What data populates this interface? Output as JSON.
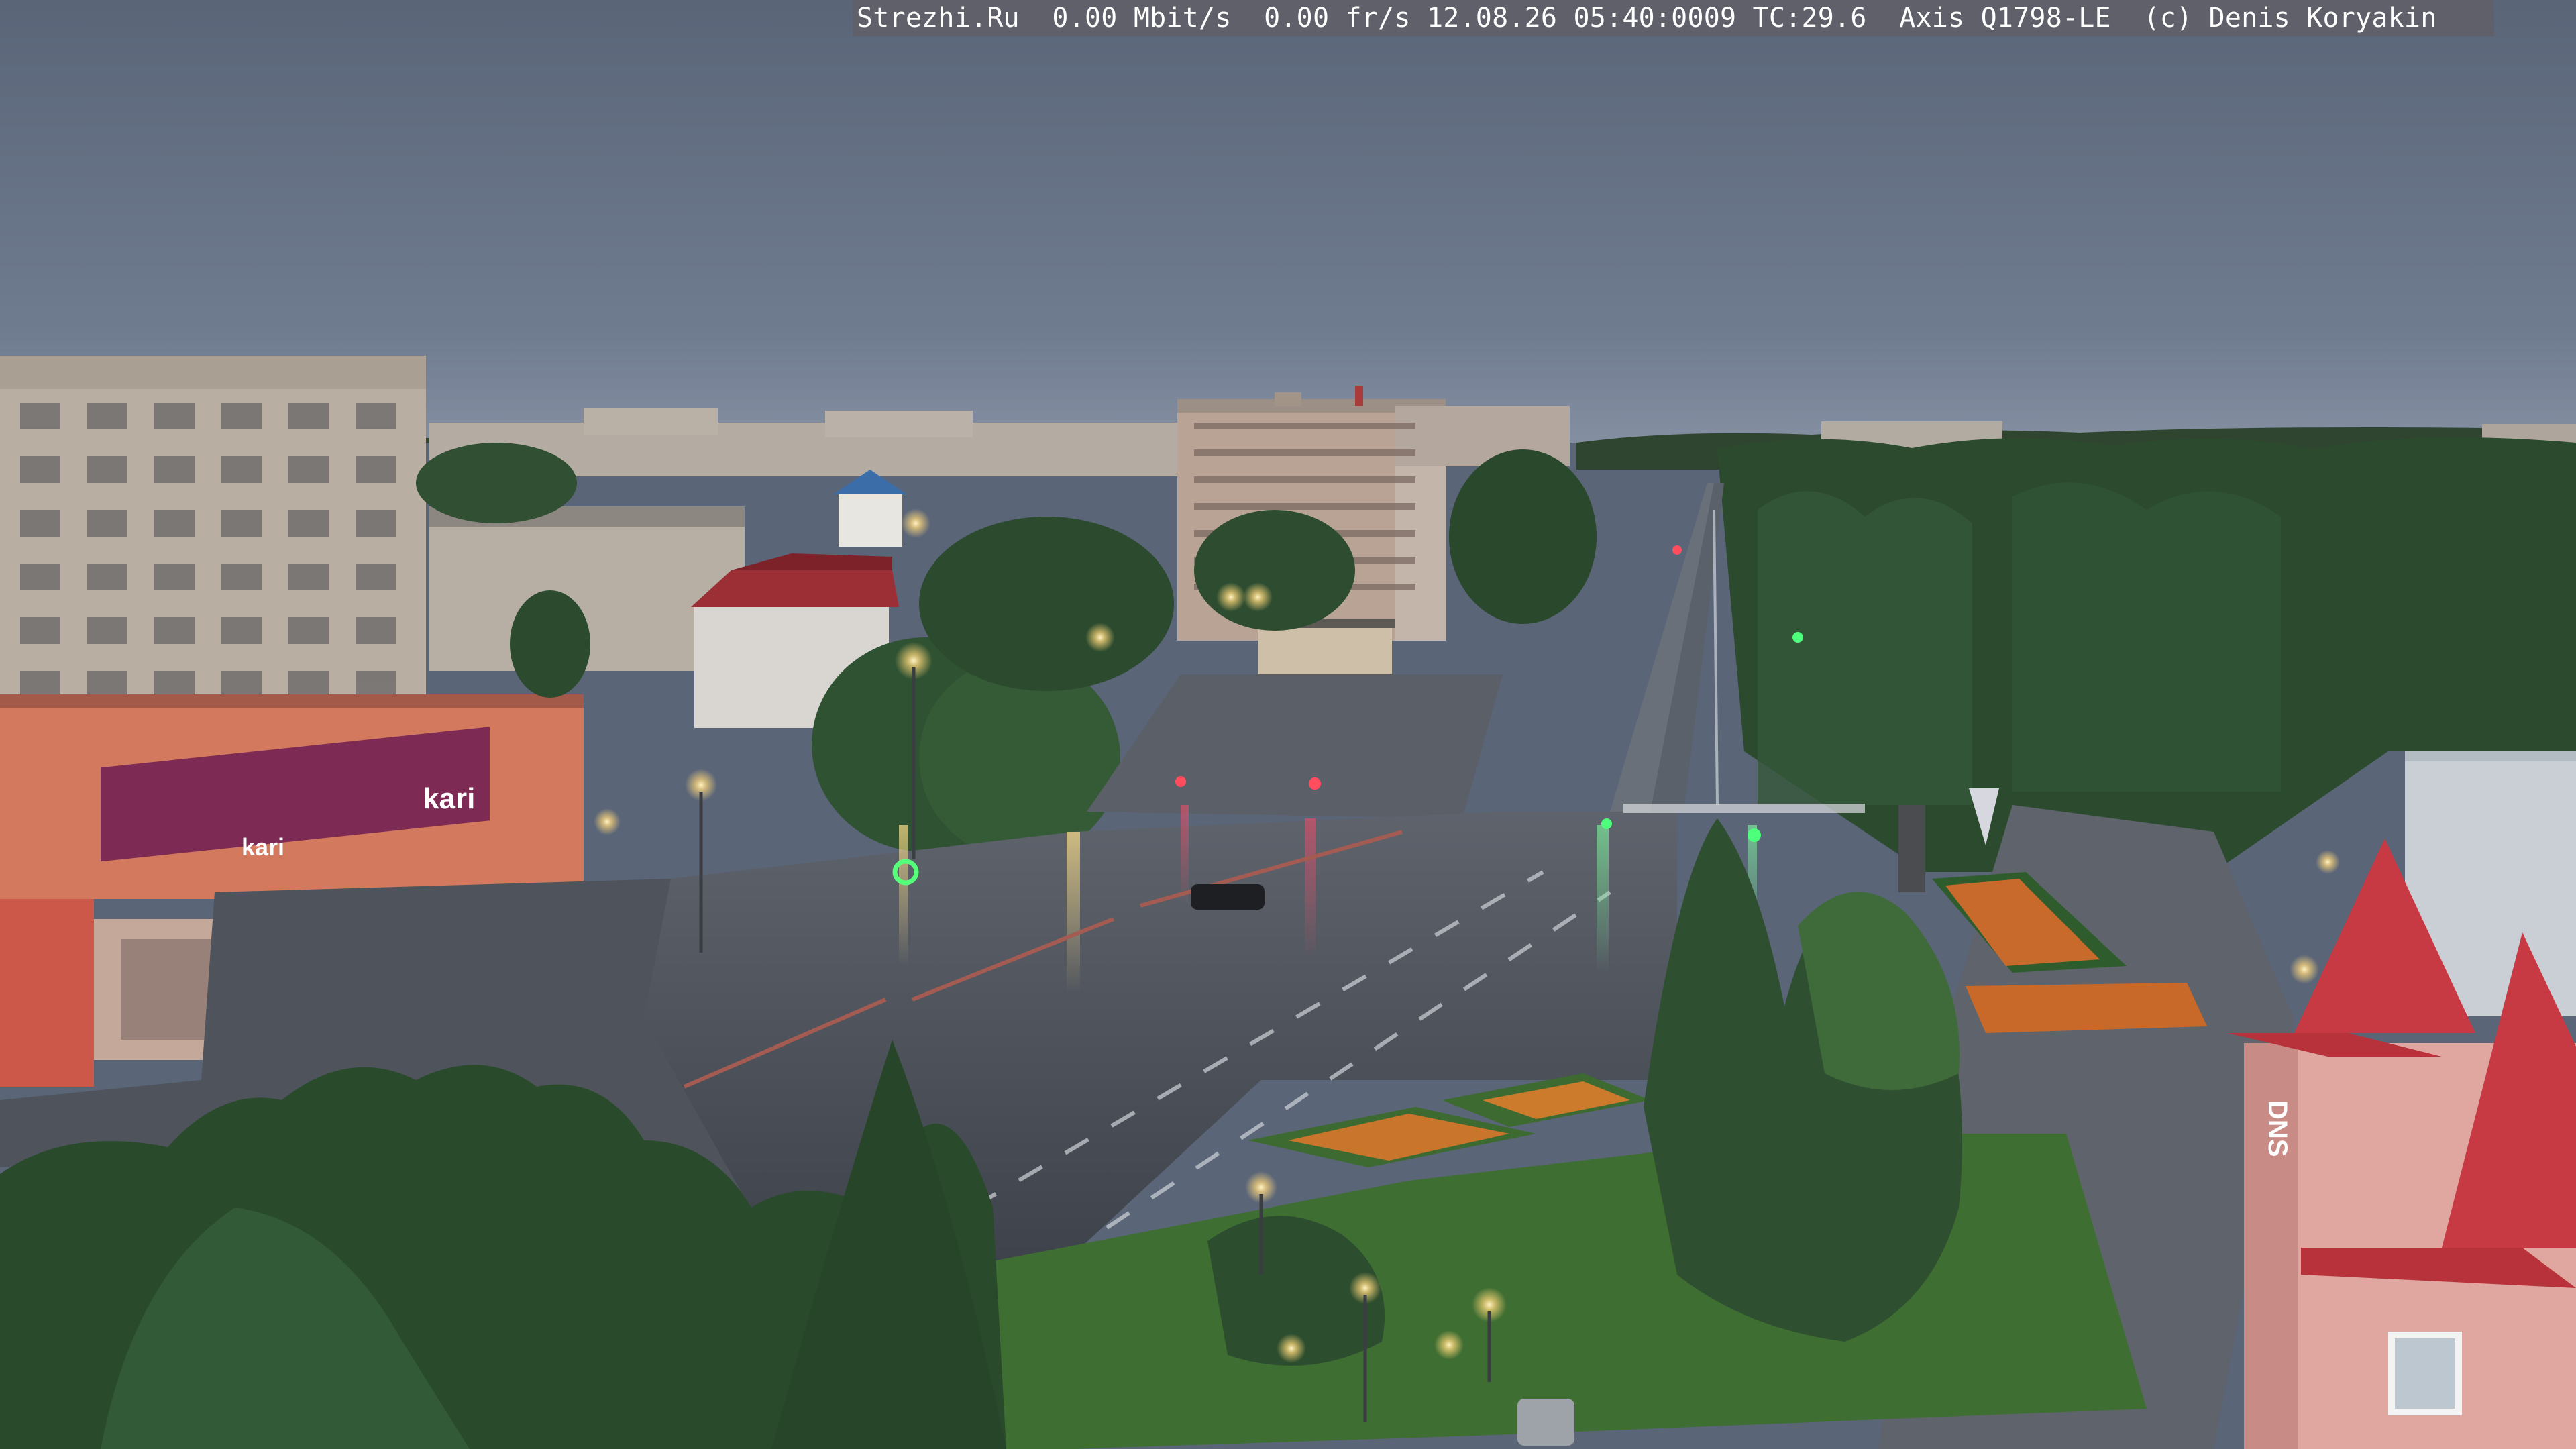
{
  "overlay": {
    "site": "Strezhi.Ru",
    "bitrate": "0.00 Mbit/s",
    "framerate": "0.00 fr/s",
    "timestamp": "12.08.26 05:40:0009",
    "temperature": "TC:29.6",
    "camera_model": "Axis Q1798-LE",
    "copyright": "(c) Denis Koryakin"
  },
  "signs": {
    "shop_name": "kari",
    "shop_name_2": "kari",
    "dns_sign": "DNS"
  },
  "colors": {
    "sky_top": "#5b6679",
    "sky_horizon": "#7d8aa0",
    "asphalt": "#4a4f57",
    "foliage": "#2c4a2e",
    "lamp_glow": "#ffd77a"
  }
}
